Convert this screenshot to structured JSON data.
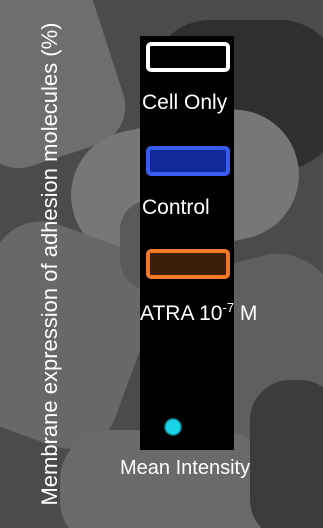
{
  "chart_data": {
    "type": "legend",
    "ylabel": "Membrane expression of adhesion molecules (%)",
    "legend": [
      {
        "label": "Cell Only",
        "fill": "#000000",
        "edge": "#ffffff"
      },
      {
        "label": "Control",
        "fill": "#102a9a",
        "edge": "#3a5cf0"
      },
      {
        "label": "ATRA 10",
        "label_sup": "-7",
        "label_suffix": " M",
        "fill": "#3a1e08",
        "edge": "#f07828"
      }
    ],
    "marker": {
      "label": "Mean Intensity",
      "color": "#19d3e6",
      "shape": "circle"
    }
  }
}
